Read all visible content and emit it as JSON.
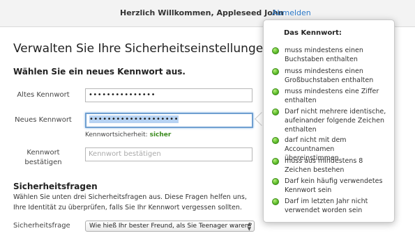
{
  "header": {
    "welcome": "Herzlich Willkommen, Appleseed John",
    "logout": "Abmelden"
  },
  "main": {
    "title": "Verwalten Sie Ihre Sicherheitseinstellungen.",
    "password_section_title": "Wählen Sie ein neues Kennwort aus.",
    "old_password": {
      "label": "Altes Kennwort",
      "value": "•••••••••••••••"
    },
    "new_password": {
      "label": "Neues Kennwort",
      "value": "••••••••••••••••••••"
    },
    "strength": {
      "label": "Kennwortsicherheit:",
      "value": "sicher",
      "color": "#3a8a1d"
    },
    "confirm_password": {
      "label_line1": "Kennwort",
      "label_line2": "bestätigen",
      "placeholder": "Kennwort bestätigen"
    },
    "security_questions": {
      "title": "Sicherheitsfragen",
      "description": "Wählen Sie unten drei Sicherheitsfragen aus. Diese Fragen helfen uns, Ihre Identität zu überprüfen, falls Sie Ihr Kennwort vergessen sollten.",
      "question_label": "Sicherheitsfrage",
      "question_selected": "Wie hieß Ihr bester Freund, als Sie Teenager waren?"
    }
  },
  "popover": {
    "title": "Das Kennwort:",
    "status_color": "#62bf2e",
    "requirements": [
      {
        "text": "muss mindestens einen Buchstaben enthalten",
        "icon": "check-dot-icon"
      },
      {
        "text": "muss mindestens einen Großbuchstaben enthalten",
        "icon": "check-dot-icon"
      },
      {
        "text": "muss mindestens eine Ziffer enthalten",
        "icon": "check-dot-icon"
      },
      {
        "text": "Darf nicht mehrere identische, aufeinander folgende Zeichen enthalten",
        "icon": "check-dot-icon"
      },
      {
        "text": "darf nicht mit dem Accountnamen übereinstimmen",
        "icon": "check-dot-icon"
      },
      {
        "text": "muss aus mindestens 8 Zeichen bestehen",
        "icon": "check-dot-icon"
      },
      {
        "text": "Darf kein häufig verwendetes Kennwort sein",
        "icon": "check-dot-icon"
      },
      {
        "text": "Darf im letzten Jahr nicht verwendet worden sein",
        "icon": "check-dot-icon"
      }
    ]
  }
}
